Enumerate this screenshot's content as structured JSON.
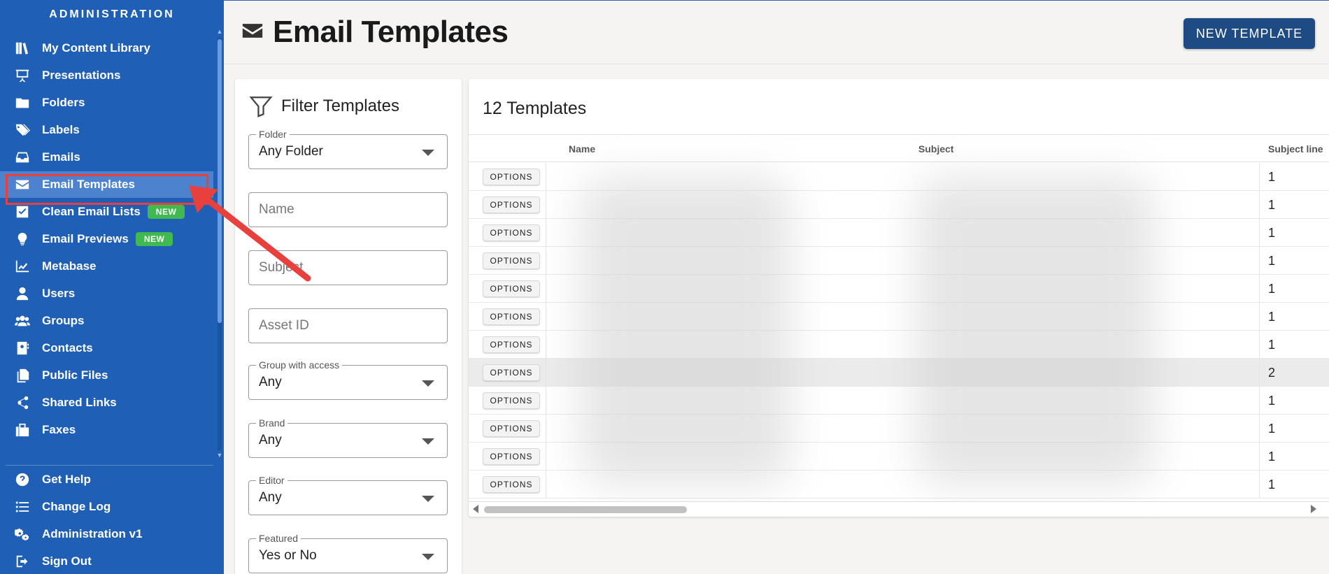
{
  "sidebar": {
    "header": "ADMINISTRATION",
    "items": [
      {
        "label": "My Content Library",
        "icon": "library-icon"
      },
      {
        "label": "Presentations",
        "icon": "presentation-icon"
      },
      {
        "label": "Folders",
        "icon": "folder-icon"
      },
      {
        "label": "Labels",
        "icon": "tags-icon"
      },
      {
        "label": "Emails",
        "icon": "inbox-icon"
      },
      {
        "label": "Email Templates",
        "icon": "envelope-icon"
      },
      {
        "label": "Clean Email Lists",
        "icon": "check-square-icon",
        "badge": "NEW"
      },
      {
        "label": "Email Previews",
        "icon": "lightbulb-icon",
        "badge": "NEW"
      },
      {
        "label": "Metabase",
        "icon": "chart-line-icon"
      },
      {
        "label": "Users",
        "icon": "user-icon"
      },
      {
        "label": "Groups",
        "icon": "users-icon"
      },
      {
        "label": "Contacts",
        "icon": "address-book-icon"
      },
      {
        "label": "Public Files",
        "icon": "files-icon"
      },
      {
        "label": "Shared Links",
        "icon": "share-icon"
      },
      {
        "label": "Faxes",
        "icon": "fax-icon"
      }
    ],
    "footer_items": [
      {
        "label": "Get Help",
        "icon": "question-circle-icon"
      },
      {
        "label": "Change Log",
        "icon": "list-icon"
      },
      {
        "label": "Administration v1",
        "icon": "gears-icon"
      },
      {
        "label": "Sign Out",
        "icon": "sign-out-icon"
      }
    ],
    "active_item": "Email Templates"
  },
  "header": {
    "title": "Email Templates",
    "title_icon": "envelope-icon",
    "new_button": "NEW TEMPLATE"
  },
  "filters": {
    "title": "Filter Templates",
    "folder": {
      "label": "Folder",
      "value": "Any Folder"
    },
    "name": {
      "placeholder": "Name"
    },
    "subject": {
      "placeholder": "Subject"
    },
    "asset_id": {
      "placeholder": "Asset ID"
    },
    "group": {
      "label": "Group with access",
      "value": "Any"
    },
    "brand": {
      "label": "Brand",
      "value": "Any"
    },
    "editor": {
      "label": "Editor",
      "value": "Any"
    },
    "featured": {
      "label": "Featured",
      "value": "Yes or No"
    }
  },
  "table": {
    "count_label": "12 Templates",
    "columns": [
      "Name",
      "Subject",
      "Subject line"
    ],
    "option_label": "OPTIONS",
    "subject_counts": [
      "1",
      "1",
      "1",
      "1",
      "1",
      "1",
      "1",
      "2",
      "1",
      "1",
      "1",
      "1"
    ],
    "selected_row": 7
  },
  "colors": {
    "sidebar": "#1f5fb5",
    "active_item": "#4d82cf",
    "badge": "#3fb950",
    "primary_button": "#1f4b85",
    "annotation": "#e8403c"
  }
}
